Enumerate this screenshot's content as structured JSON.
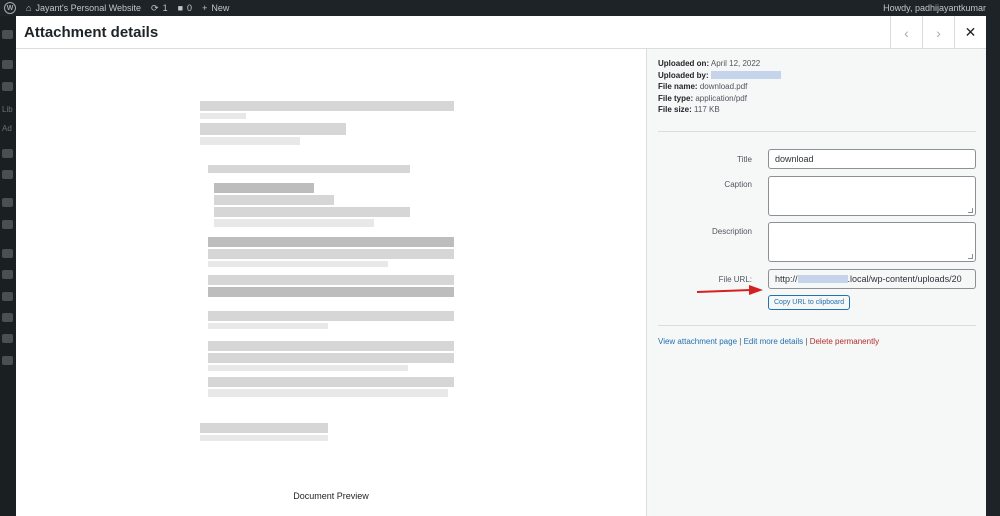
{
  "adminbar": {
    "site_name": "Jayant's Personal Website",
    "updates_count": "1",
    "comments_count": "0",
    "new_label": "New",
    "howdy": "Howdy, padhijayantkumar"
  },
  "leftmenu": {
    "fragments": [
      "Lib",
      "Ad"
    ]
  },
  "modal": {
    "title": "Attachment details",
    "prev_icon": "chevron-left-icon",
    "next_icon": "chevron-right-icon",
    "close_icon": "close-icon"
  },
  "preview": {
    "caption": "Document Preview"
  },
  "details": {
    "uploaded_on_label": "Uploaded on:",
    "uploaded_on": "April 12, 2022",
    "uploaded_by_label": "Uploaded by:",
    "file_name_label": "File name:",
    "file_name": "download.pdf",
    "file_type_label": "File type:",
    "file_type": "application/pdf",
    "file_size_label": "File size:",
    "file_size": "117 KB"
  },
  "form": {
    "title_label": "Title",
    "title_value": "download",
    "caption_label": "Caption",
    "caption_value": "",
    "description_label": "Description",
    "description_value": "",
    "file_url_label": "File URL:",
    "file_url_prefix": "http://",
    "file_url_suffix": ".local/wp-content/uploads/20",
    "copy_button": "Copy URL to clipboard"
  },
  "links": {
    "view": "View attachment page",
    "edit": "Edit more details",
    "delete": "Delete permanently",
    "separator": "|"
  },
  "colors": {
    "accent": "#2271b1",
    "delete": "#b32d2e",
    "annotation_arrow": "#d61f1f"
  }
}
